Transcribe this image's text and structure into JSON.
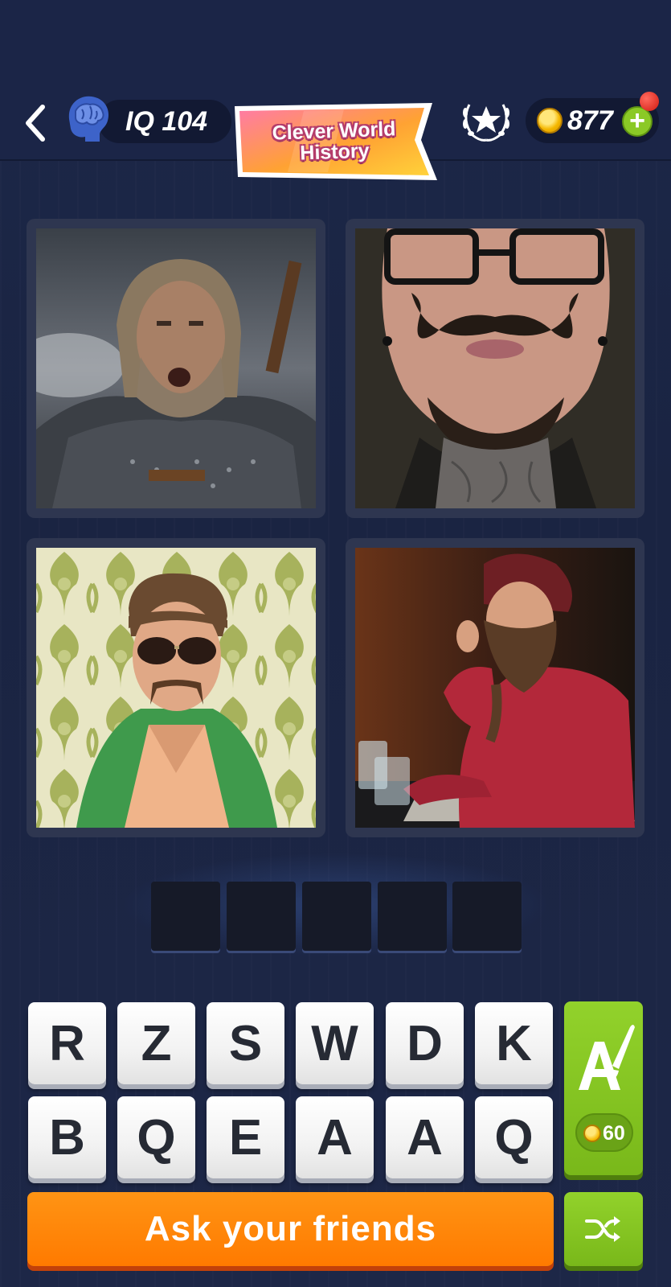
{
  "header": {
    "iq_label": "IQ 104",
    "category_title": "Clever World History",
    "coins": "877"
  },
  "pictures": [
    {
      "name": "picture-viking-warrior"
    },
    {
      "name": "picture-mustache-glasses"
    },
    {
      "name": "picture-sunglasses-green-jacket"
    },
    {
      "name": "picture-beard-on-phone"
    }
  ],
  "answer": {
    "length": 5,
    "letters": [
      "",
      "",
      "",
      "",
      ""
    ]
  },
  "keyboard": {
    "row1": [
      "R",
      "Z",
      "S",
      "W",
      "D",
      "K"
    ],
    "row2": [
      "B",
      "Q",
      "E",
      "A",
      "A",
      "Q"
    ]
  },
  "buttons": {
    "ask_friends": "Ask your friends",
    "paint_hint_cost": "60"
  },
  "colors": {
    "accent_orange": "#ff7a00",
    "accent_green": "#86c823",
    "background": "#1c2748"
  }
}
